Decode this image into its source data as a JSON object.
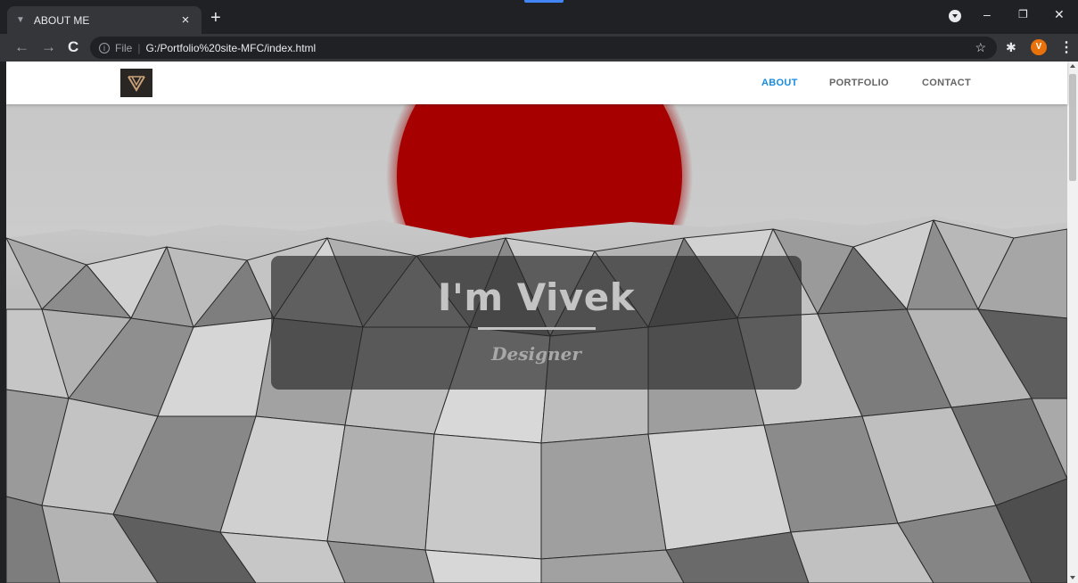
{
  "browser": {
    "tab_title": "ABOUT ME",
    "tab_close": "×",
    "new_tab": "+",
    "favicon": "▼",
    "url_scheme_label": "File",
    "url_path": "G:/Portfolio%20site-MFC/index.html",
    "profile_initial": "V",
    "window_controls": {
      "minimize": "–",
      "restore": "❐",
      "close": "✕"
    },
    "back": "←",
    "forward": "→",
    "reload": "C",
    "info": "i",
    "star": "☆",
    "extensions": "✱",
    "menu": "⋮"
  },
  "site": {
    "nav": [
      {
        "label": "ABOUT",
        "active": true
      },
      {
        "label": "PORTFOLIO",
        "active": false
      },
      {
        "label": "CONTACT",
        "active": false
      }
    ],
    "hero": {
      "title": "I'm Vivek",
      "subtitle": "Designer"
    }
  },
  "colors": {
    "accent": "#1a8ce0",
    "sun": "#a30000",
    "chrome_dark": "#202124",
    "chrome_toolbar": "#35363a"
  }
}
